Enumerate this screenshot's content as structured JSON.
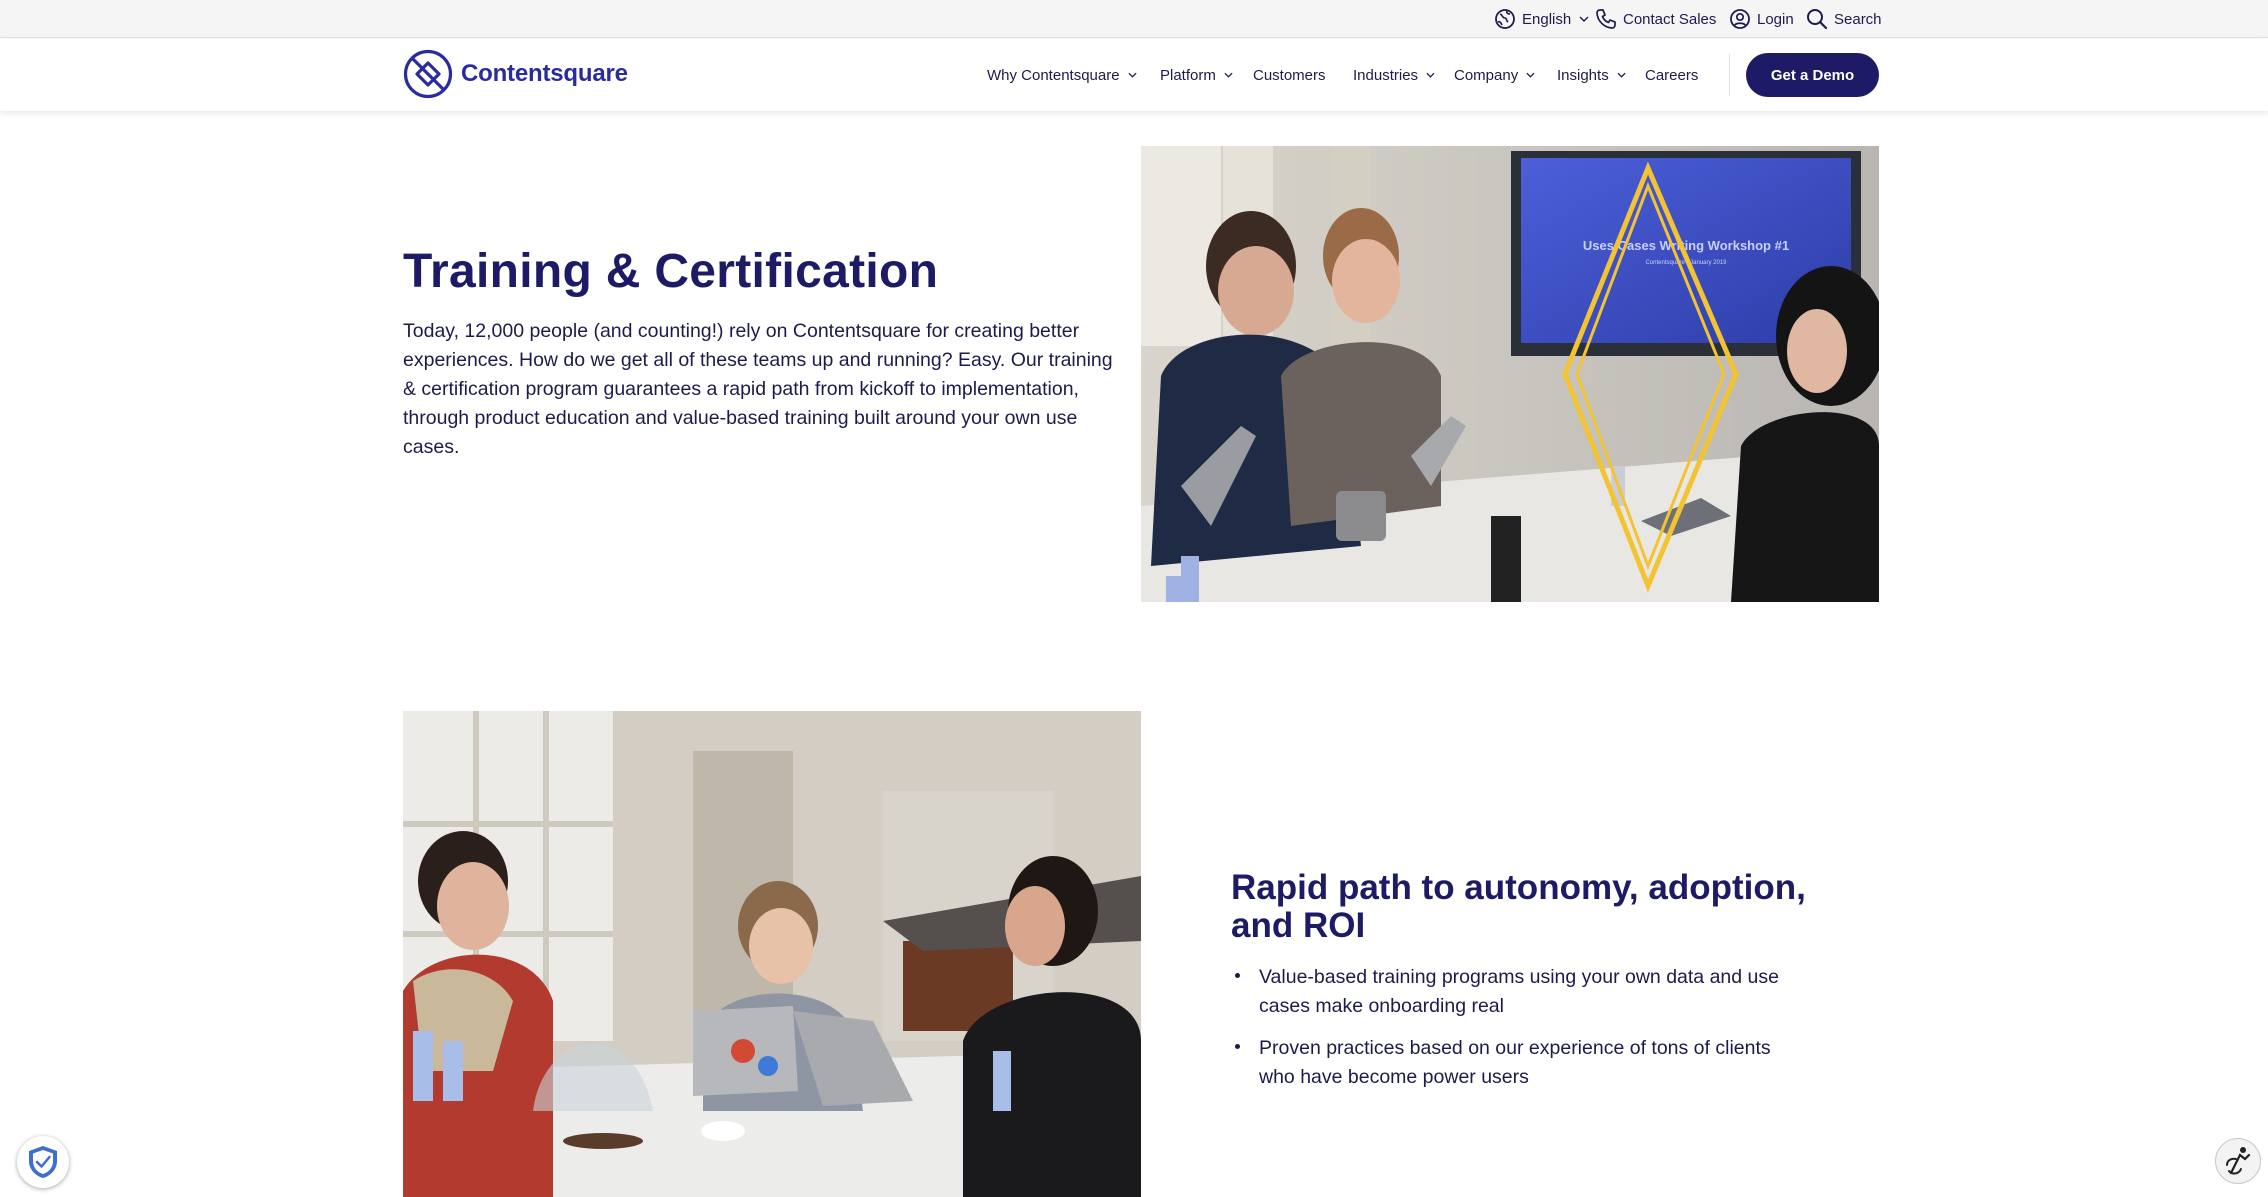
{
  "utility_bar": {
    "language": "English",
    "contact_sales": "Contact Sales",
    "login": "Login",
    "search": "Search"
  },
  "header": {
    "logo_text": "Contentsquare",
    "nav": [
      {
        "label": "Why Contentsquare",
        "has_dropdown": true
      },
      {
        "label": "Platform",
        "has_dropdown": true
      },
      {
        "label": "Customers",
        "has_dropdown": false
      },
      {
        "label": "Industries",
        "has_dropdown": true
      },
      {
        "label": "Company",
        "has_dropdown": true
      },
      {
        "label": "Insights",
        "has_dropdown": true
      },
      {
        "label": "Careers",
        "has_dropdown": false
      }
    ],
    "cta": "Get a Demo"
  },
  "section_training": {
    "title": "Training & Certification",
    "body": "Today, 12,000 people (and counting!) rely on Contentsquare for creating better experiences. How do we get all of these teams up and running? Easy. Our training & certification program guarantees a rapid path from kickoff to implementation, through product education and value-based training built around your own use cases."
  },
  "section_autonomy": {
    "title": "Rapid path to autonomy, adoption, and ROI",
    "bullets": [
      "Value-based training programs using your own data and use cases make onboarding real",
      "Proven practices based on our experience of  tons of clients who have become power users"
    ]
  },
  "photo_workshop": {
    "screen_title": "Uses Cases Writing Workshop #1",
    "screen_subtitle": "Contentsquare · January 2019"
  },
  "colors": {
    "brand_navy": "#1d1b66",
    "logo_blue": "#2a2b9f",
    "text": "#1d1b4c",
    "accent_yellow": "#f3c431",
    "utility_bg": "#f5f5f5"
  },
  "icons": {
    "language": "globe-icon",
    "contact": "phone-icon",
    "login": "user-circle-icon",
    "search": "search-icon",
    "dropdown": "chevron-down-icon",
    "consent": "shield-check-icon",
    "accessibility": "accessibility-icon"
  }
}
